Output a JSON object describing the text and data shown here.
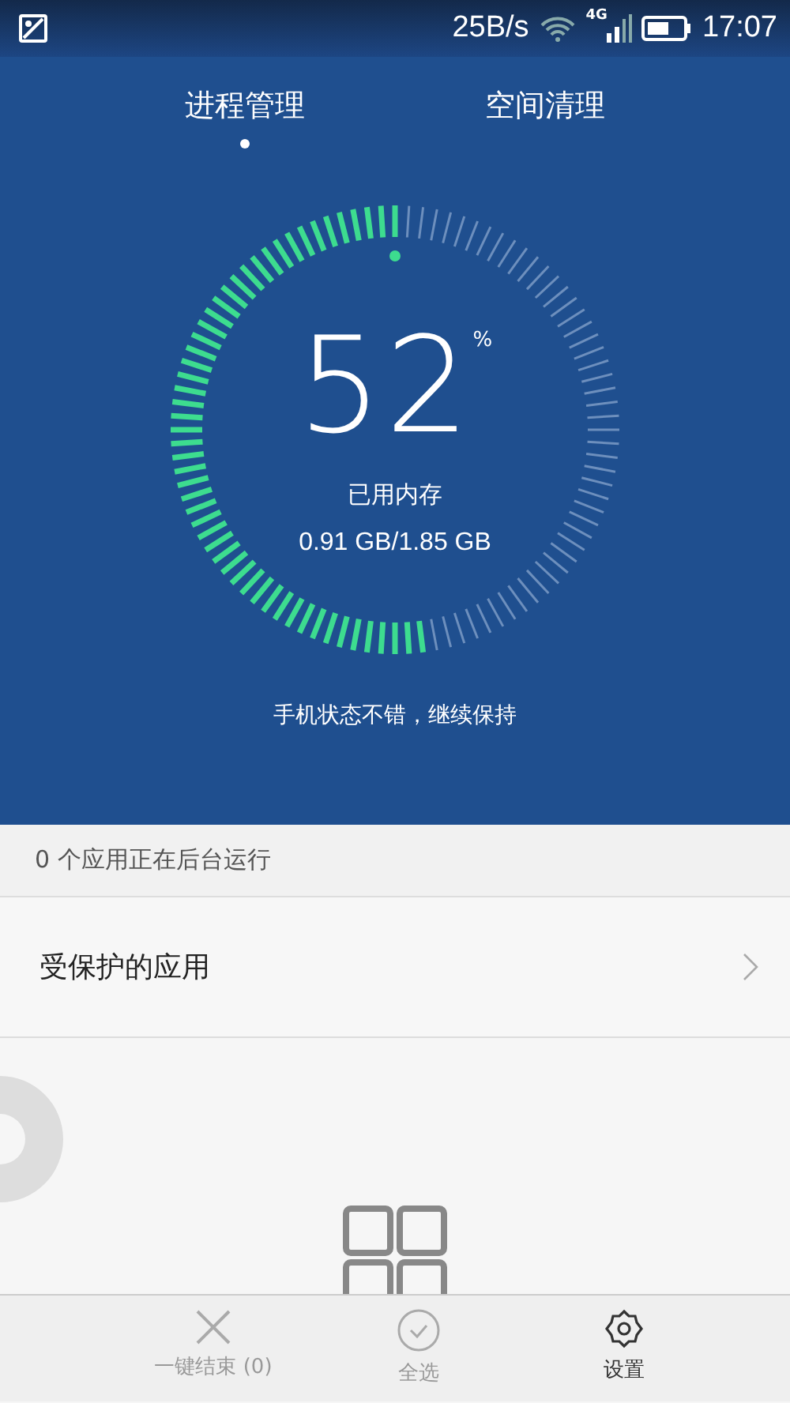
{
  "status_bar": {
    "speed": "25B/s",
    "network": "4G",
    "time": "17:07"
  },
  "tabs": [
    {
      "label": "进程管理",
      "selected": true
    },
    {
      "label": "空间清理",
      "selected": false
    }
  ],
  "memory": {
    "level": 0.52,
    "percent": "52",
    "unit": "%",
    "label": "已用内存",
    "usage": "0.91 GB/1.85 GB",
    "message": "手机状态不错，继续保持"
  },
  "section_header": "0 个应用正在后台运行",
  "list": [
    {
      "label": "受保护的应用"
    }
  ],
  "bottom_bar": [
    {
      "kind": "close",
      "label": "一键结束 (0)",
      "disabled": true
    },
    {
      "kind": "check",
      "label": "全选",
      "disabled": true
    },
    {
      "kind": "settings",
      "label": "设置",
      "disabled": false
    }
  ]
}
